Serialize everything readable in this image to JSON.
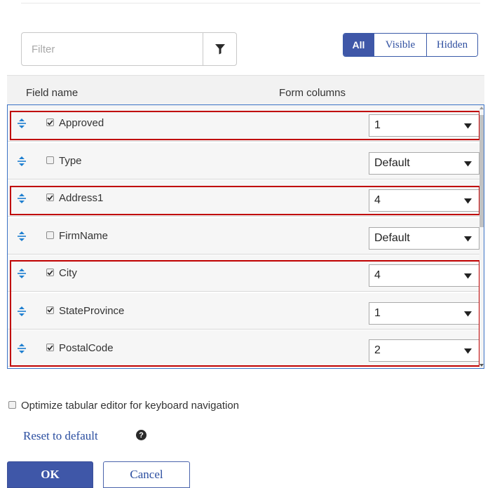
{
  "filter": {
    "placeholder": "Filter",
    "value": "",
    "button_icon": "funnel-icon"
  },
  "view_toggle": {
    "options": [
      "All",
      "Visible",
      "Hidden"
    ],
    "selected": "All"
  },
  "grid": {
    "columns": [
      "Field name",
      "Form columns"
    ],
    "rows": [
      {
        "name": "Approved",
        "checked": true,
        "columns": "1"
      },
      {
        "name": "Type",
        "checked": false,
        "columns": "Default"
      },
      {
        "name": "Address1",
        "checked": true,
        "columns": "4"
      },
      {
        "name": "FirmName",
        "checked": false,
        "columns": "Default"
      },
      {
        "name": "City",
        "checked": true,
        "columns": "4"
      },
      {
        "name": "StateProvince",
        "checked": true,
        "columns": "1"
      },
      {
        "name": "PostalCode",
        "checked": true,
        "columns": "2"
      }
    ]
  },
  "options": {
    "keyboard_nav_label": "Optimize tabular editor for keyboard navigation",
    "keyboard_nav_checked": false
  },
  "links": {
    "reset": "Reset to default"
  },
  "help": {
    "glyph": "?"
  },
  "buttons": {
    "ok": "OK",
    "cancel": "Cancel"
  },
  "colors": {
    "primary": "#3f57a8",
    "highlight": "#c00000",
    "drag_handle": "#1e7fd0",
    "grid_border": "#3a72c6"
  }
}
